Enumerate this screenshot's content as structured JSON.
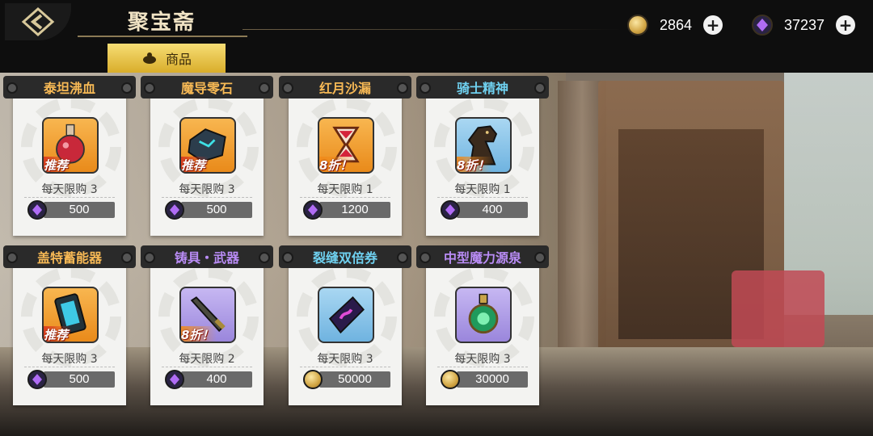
{
  "header": {
    "title": "聚宝斋",
    "tab_label": "商品"
  },
  "currency": {
    "gold": "2864",
    "gems": "37237"
  },
  "colors": {
    "tab_gold": "#e8c24b",
    "name_orange": "#f7b955",
    "name_cyan": "#6fd1f0",
    "name_purple": "#b98cf5"
  },
  "items": [
    {
      "name": "泰坦沸血",
      "tag": "推荐",
      "limit": "每天限购 3",
      "price": "500",
      "currency_icon": "gem-icon",
      "icon": "potion-icon"
    },
    {
      "name": "魔导零石",
      "tag": "推荐",
      "limit": "每天限购 3",
      "price": "500",
      "currency_icon": "gem-icon",
      "icon": "stone-icon"
    },
    {
      "name": "红月沙漏",
      "tag": "8折！",
      "limit": "每天限购 1",
      "price": "1200",
      "currency_icon": "gem-icon",
      "icon": "hourglass-icon"
    },
    {
      "name": "骑士精神",
      "tag": "8折！",
      "limit": "每天限购 1",
      "price": "400",
      "currency_icon": "gem-icon",
      "icon": "knight-icon"
    },
    {
      "name": "盖特蓄能器",
      "tag": "推荐",
      "limit": "每天限购 3",
      "price": "500",
      "currency_icon": "gem-icon",
      "icon": "battery-icon"
    },
    {
      "name": "铸具・武器",
      "tag": "8折！",
      "limit": "每天限购 2",
      "price": "400",
      "currency_icon": "gem-icon",
      "icon": "sword-icon"
    },
    {
      "name": "裂缝双倍券",
      "tag": "",
      "limit": "每天限购 3",
      "price": "50000",
      "currency_icon": "coin-icon",
      "icon": "ticket-icon"
    },
    {
      "name": "中型魔力源泉",
      "tag": "",
      "limit": "每天限购 3",
      "price": "30000",
      "currency_icon": "coin-icon",
      "icon": "flask-icon"
    }
  ]
}
